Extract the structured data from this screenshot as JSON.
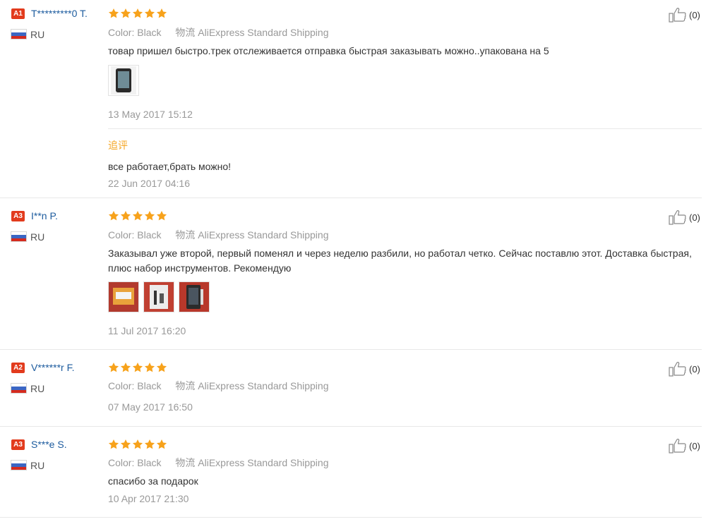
{
  "colors": {
    "badge": "#e23b1d",
    "name": "#1c5b9e",
    "star": "#f7a21b",
    "followup": "#f5a623",
    "muted": "#999999"
  },
  "reviews": [
    {
      "level": "A1",
      "name": "T*********0 T.",
      "country": "RU",
      "stars": 5,
      "color_key": "Color:",
      "color_value": "Black",
      "shipping_key": "物流",
      "shipping_value": "AliExpress Standard Shipping",
      "text": "товар пришел быстро.трек отслеживается отправка быстрая заказывать можно..упакована на 5",
      "photos": [
        "phone-screen-photo"
      ],
      "date": "13 May 2017 15:12",
      "likes": "(0)",
      "followup_label": "追评",
      "followup_text": "все работает,брать можно!",
      "followup_date": "22 Jun 2017 04:16"
    },
    {
      "level": "A3",
      "name": "I**n P.",
      "country": "RU",
      "stars": 5,
      "color_key": "Color:",
      "color_value": "Black",
      "shipping_key": "物流",
      "shipping_value": "AliExpress Standard Shipping",
      "text": "Заказывал уже второй, первый поменял и через неделю разбили, но работал четко. Сейчас поставлю этот. Доставка быстрая, плюс набор инструментов. Рекомендую",
      "photos": [
        "package-photo",
        "tool-kit-photo",
        "screen-assembly-photo"
      ],
      "date": "11 Jul 2017 16:20",
      "likes": "(0)"
    },
    {
      "level": "A2",
      "name": "V******r F.",
      "country": "RU",
      "stars": 5,
      "color_key": "Color:",
      "color_value": "Black",
      "shipping_key": "物流",
      "shipping_value": "AliExpress Standard Shipping",
      "date": "07 May 2017 16:50",
      "likes": "(0)"
    },
    {
      "level": "A3",
      "name": "S***e S.",
      "country": "RU",
      "stars": 5,
      "color_key": "Color:",
      "color_value": "Black",
      "shipping_key": "物流",
      "shipping_value": "AliExpress Standard Shipping",
      "text": "спасибо за подарок",
      "date": "10 Apr 2017 21:30",
      "likes": "(0)"
    }
  ]
}
